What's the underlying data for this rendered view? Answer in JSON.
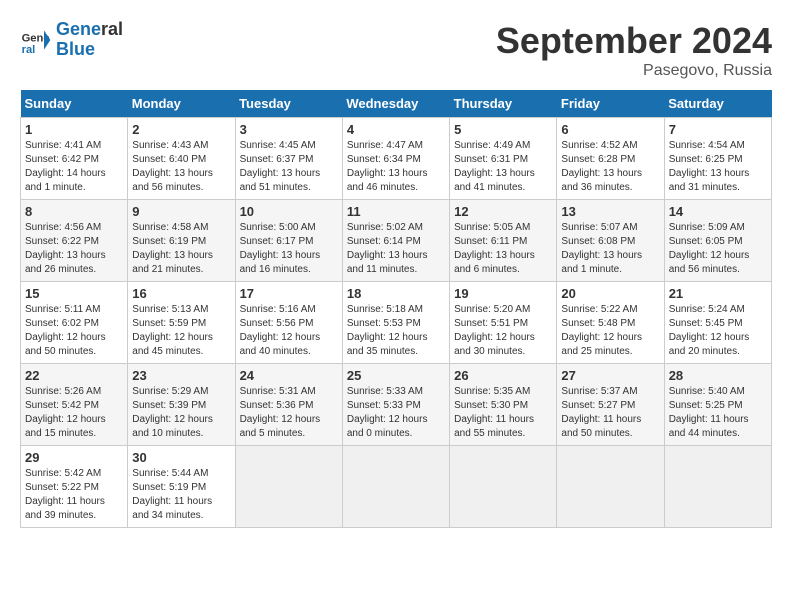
{
  "header": {
    "logo_line1": "General",
    "logo_line2": "Blue",
    "month_year": "September 2024",
    "location": "Pasegovo, Russia"
  },
  "columns": [
    "Sunday",
    "Monday",
    "Tuesday",
    "Wednesday",
    "Thursday",
    "Friday",
    "Saturday"
  ],
  "weeks": [
    [
      {
        "day": "1",
        "sunrise": "Sunrise: 4:41 AM",
        "sunset": "Sunset: 6:42 PM",
        "daylight": "Daylight: 14 hours and 1 minute."
      },
      {
        "day": "2",
        "sunrise": "Sunrise: 4:43 AM",
        "sunset": "Sunset: 6:40 PM",
        "daylight": "Daylight: 13 hours and 56 minutes."
      },
      {
        "day": "3",
        "sunrise": "Sunrise: 4:45 AM",
        "sunset": "Sunset: 6:37 PM",
        "daylight": "Daylight: 13 hours and 51 minutes."
      },
      {
        "day": "4",
        "sunrise": "Sunrise: 4:47 AM",
        "sunset": "Sunset: 6:34 PM",
        "daylight": "Daylight: 13 hours and 46 minutes."
      },
      {
        "day": "5",
        "sunrise": "Sunrise: 4:49 AM",
        "sunset": "Sunset: 6:31 PM",
        "daylight": "Daylight: 13 hours and 41 minutes."
      },
      {
        "day": "6",
        "sunrise": "Sunrise: 4:52 AM",
        "sunset": "Sunset: 6:28 PM",
        "daylight": "Daylight: 13 hours and 36 minutes."
      },
      {
        "day": "7",
        "sunrise": "Sunrise: 4:54 AM",
        "sunset": "Sunset: 6:25 PM",
        "daylight": "Daylight: 13 hours and 31 minutes."
      }
    ],
    [
      {
        "day": "8",
        "sunrise": "Sunrise: 4:56 AM",
        "sunset": "Sunset: 6:22 PM",
        "daylight": "Daylight: 13 hours and 26 minutes."
      },
      {
        "day": "9",
        "sunrise": "Sunrise: 4:58 AM",
        "sunset": "Sunset: 6:19 PM",
        "daylight": "Daylight: 13 hours and 21 minutes."
      },
      {
        "day": "10",
        "sunrise": "Sunrise: 5:00 AM",
        "sunset": "Sunset: 6:17 PM",
        "daylight": "Daylight: 13 hours and 16 minutes."
      },
      {
        "day": "11",
        "sunrise": "Sunrise: 5:02 AM",
        "sunset": "Sunset: 6:14 PM",
        "daylight": "Daylight: 13 hours and 11 minutes."
      },
      {
        "day": "12",
        "sunrise": "Sunrise: 5:05 AM",
        "sunset": "Sunset: 6:11 PM",
        "daylight": "Daylight: 13 hours and 6 minutes."
      },
      {
        "day": "13",
        "sunrise": "Sunrise: 5:07 AM",
        "sunset": "Sunset: 6:08 PM",
        "daylight": "Daylight: 13 hours and 1 minute."
      },
      {
        "day": "14",
        "sunrise": "Sunrise: 5:09 AM",
        "sunset": "Sunset: 6:05 PM",
        "daylight": "Daylight: 12 hours and 56 minutes."
      }
    ],
    [
      {
        "day": "15",
        "sunrise": "Sunrise: 5:11 AM",
        "sunset": "Sunset: 6:02 PM",
        "daylight": "Daylight: 12 hours and 50 minutes."
      },
      {
        "day": "16",
        "sunrise": "Sunrise: 5:13 AM",
        "sunset": "Sunset: 5:59 PM",
        "daylight": "Daylight: 12 hours and 45 minutes."
      },
      {
        "day": "17",
        "sunrise": "Sunrise: 5:16 AM",
        "sunset": "Sunset: 5:56 PM",
        "daylight": "Daylight: 12 hours and 40 minutes."
      },
      {
        "day": "18",
        "sunrise": "Sunrise: 5:18 AM",
        "sunset": "Sunset: 5:53 PM",
        "daylight": "Daylight: 12 hours and 35 minutes."
      },
      {
        "day": "19",
        "sunrise": "Sunrise: 5:20 AM",
        "sunset": "Sunset: 5:51 PM",
        "daylight": "Daylight: 12 hours and 30 minutes."
      },
      {
        "day": "20",
        "sunrise": "Sunrise: 5:22 AM",
        "sunset": "Sunset: 5:48 PM",
        "daylight": "Daylight: 12 hours and 25 minutes."
      },
      {
        "day": "21",
        "sunrise": "Sunrise: 5:24 AM",
        "sunset": "Sunset: 5:45 PM",
        "daylight": "Daylight: 12 hours and 20 minutes."
      }
    ],
    [
      {
        "day": "22",
        "sunrise": "Sunrise: 5:26 AM",
        "sunset": "Sunset: 5:42 PM",
        "daylight": "Daylight: 12 hours and 15 minutes."
      },
      {
        "day": "23",
        "sunrise": "Sunrise: 5:29 AM",
        "sunset": "Sunset: 5:39 PM",
        "daylight": "Daylight: 12 hours and 10 minutes."
      },
      {
        "day": "24",
        "sunrise": "Sunrise: 5:31 AM",
        "sunset": "Sunset: 5:36 PM",
        "daylight": "Daylight: 12 hours and 5 minutes."
      },
      {
        "day": "25",
        "sunrise": "Sunrise: 5:33 AM",
        "sunset": "Sunset: 5:33 PM",
        "daylight": "Daylight: 12 hours and 0 minutes."
      },
      {
        "day": "26",
        "sunrise": "Sunrise: 5:35 AM",
        "sunset": "Sunset: 5:30 PM",
        "daylight": "Daylight: 11 hours and 55 minutes."
      },
      {
        "day": "27",
        "sunrise": "Sunrise: 5:37 AM",
        "sunset": "Sunset: 5:27 PM",
        "daylight": "Daylight: 11 hours and 50 minutes."
      },
      {
        "day": "28",
        "sunrise": "Sunrise: 5:40 AM",
        "sunset": "Sunset: 5:25 PM",
        "daylight": "Daylight: 11 hours and 44 minutes."
      }
    ],
    [
      {
        "day": "29",
        "sunrise": "Sunrise: 5:42 AM",
        "sunset": "Sunset: 5:22 PM",
        "daylight": "Daylight: 11 hours and 39 minutes."
      },
      {
        "day": "30",
        "sunrise": "Sunrise: 5:44 AM",
        "sunset": "Sunset: 5:19 PM",
        "daylight": "Daylight: 11 hours and 34 minutes."
      },
      null,
      null,
      null,
      null,
      null
    ]
  ]
}
